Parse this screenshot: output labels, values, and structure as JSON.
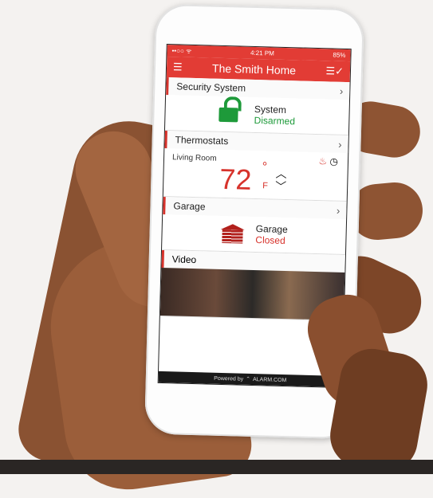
{
  "statusbar": {
    "carrier": "••○○ ᯤ",
    "time": "4:21 PM",
    "battery": "85%"
  },
  "appbar": {
    "title": "The Smith Home"
  },
  "security": {
    "heading": "Security System",
    "label": "System",
    "state": "Disarmed",
    "icon": "unlocked-padlock-icon",
    "state_color": "#1e9a3a"
  },
  "thermostats": {
    "heading": "Thermostats",
    "room": "Living Room",
    "temperature": "72",
    "unit": "F"
  },
  "garage": {
    "heading": "Garage",
    "label": "Garage",
    "state": "Closed",
    "icon": "garage-door-icon",
    "state_color": "#d7332c"
  },
  "video": {
    "heading": "Video"
  },
  "footer": {
    "powered_by": "Powered by",
    "brand": "ALARM.COM"
  },
  "colors": {
    "accent": "#e23c35"
  }
}
